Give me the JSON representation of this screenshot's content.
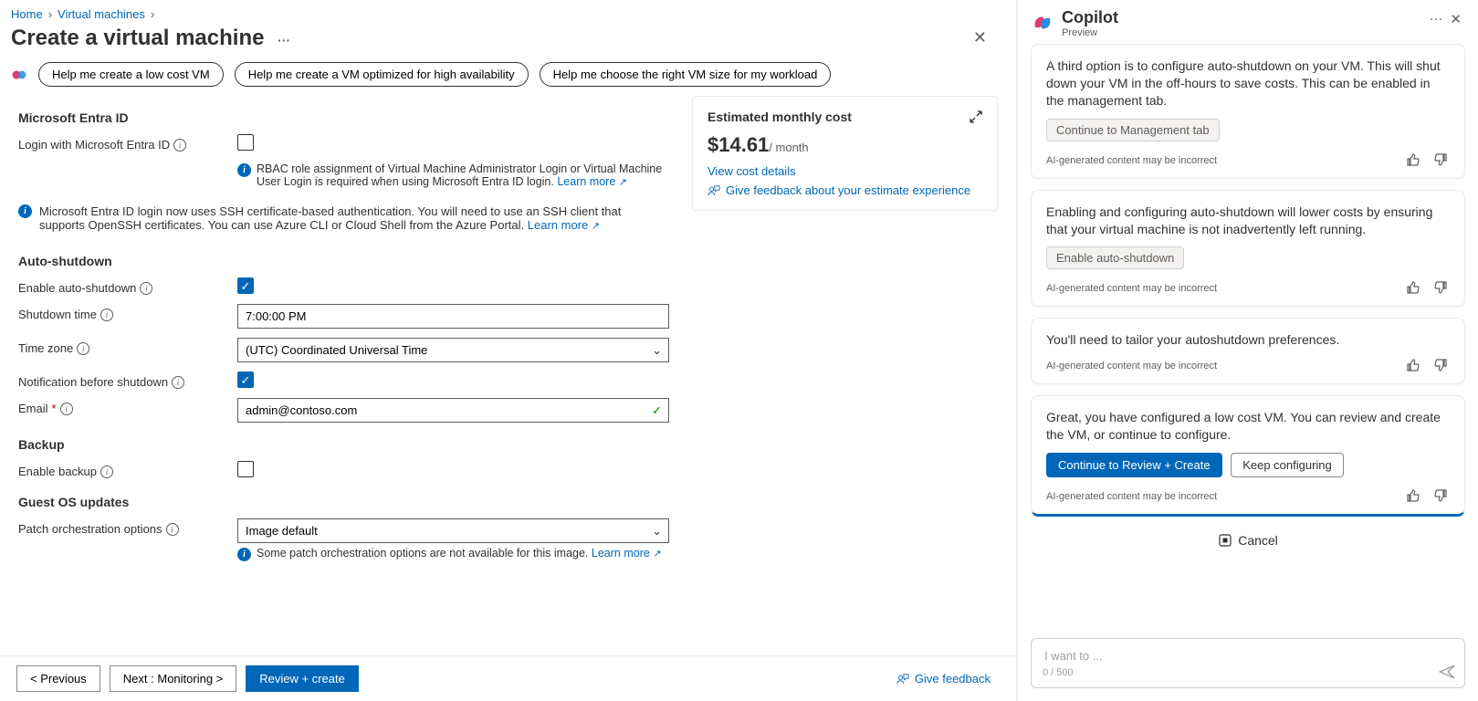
{
  "breadcrumb": {
    "home": "Home",
    "vms": "Virtual machines"
  },
  "page": {
    "title": "Create a virtual machine"
  },
  "pills": {
    "p1": "Help me create a low cost VM",
    "p2": "Help me create a VM optimized for high availability",
    "p3": "Help me choose the right VM size for my workload"
  },
  "sections": {
    "entra": "Microsoft Entra ID",
    "auto": "Auto-shutdown",
    "backup": "Backup",
    "guest": "Guest OS updates"
  },
  "labels": {
    "loginEntra": "Login with Microsoft Entra ID",
    "enableAuto": "Enable auto-shutdown",
    "shutdownTime": "Shutdown time",
    "timezone": "Time zone",
    "notifyBefore": "Notification before shutdown",
    "email": "Email",
    "enableBackup": "Enable backup",
    "patchOptions": "Patch orchestration options"
  },
  "values": {
    "shutdownTime": "7:00:00 PM",
    "timezone": "(UTC) Coordinated Universal Time",
    "email": "admin@contoso.com",
    "patchOptions": "Image default"
  },
  "info": {
    "rbac": "RBAC role assignment of Virtual Machine Administrator Login or Virtual Machine User Login is required when using Microsoft Entra ID login.",
    "sshBanner": "Microsoft Entra ID login now uses SSH certificate-based authentication. You will need to use an SSH client that supports OpenSSH certificates. You can use Azure CLI or Cloud Shell from the Azure Portal.",
    "patch": "Some patch orchestration options are not available for this image.",
    "learnMore": "Learn more"
  },
  "cost": {
    "title": "Estimated monthly cost",
    "price": "$14.61",
    "suffix": "/ month",
    "viewDetails": "View cost details",
    "feedback": "Give feedback about your estimate experience"
  },
  "footer": {
    "prev": "<  Previous",
    "next": "Next : Monitoring  >",
    "review": "Review + create",
    "feedback": "Give feedback"
  },
  "copilot": {
    "title": "Copilot",
    "subtitle": "Preview",
    "disclaimer": "AI-generated content may be incorrect",
    "cancel": "Cancel",
    "placeholder": "I want to ...",
    "counter": "0 / 500",
    "cards": [
      {
        "text": "A third option is to configure auto-shutdown on your VM. This will shut down your VM in the off-hours to save costs. This can be enabled in the management tab.",
        "chip": "Continue to Management tab"
      },
      {
        "text": "Enabling and configuring auto-shutdown will lower costs by ensuring that your virtual machine is not inadvertently left running.",
        "chip": "Enable auto-shutdown"
      },
      {
        "text": "You'll need to tailor your autoshutdown preferences."
      },
      {
        "text": "Great, you have configured a low cost VM. You can review and create the VM, or continue to configure.",
        "primary": "Continue to Review + Create",
        "secondary": "Keep configuring"
      }
    ]
  }
}
